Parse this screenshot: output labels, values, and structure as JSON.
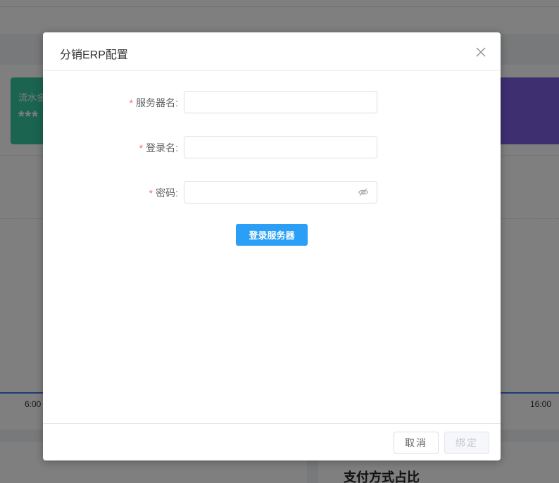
{
  "background": {
    "card_green": {
      "label": "流水金",
      "value": "***"
    },
    "chart": {
      "x_ticks": [
        "6:00",
        "16:00"
      ]
    },
    "section_title": "支付方式占比",
    "colors": {
      "card_green": "#36c9a0",
      "card_purple": "#7a5ee0",
      "chart_line": "#3e7bf0"
    }
  },
  "dialog": {
    "title": "分销ERP配置",
    "close_icon": "close-icon",
    "form": {
      "required_mark": "*",
      "fields": [
        {
          "label": "服务器名:",
          "value": "",
          "placeholder": ""
        },
        {
          "label": "登录名:",
          "value": "",
          "placeholder": ""
        },
        {
          "label": "密码:",
          "value": "",
          "placeholder": "",
          "icon": "eye-off-icon"
        }
      ]
    },
    "login_button": "登录服务器",
    "footer": {
      "cancel": "取消",
      "bind": "绑定"
    },
    "colors": {
      "primary": "#2a9ff5",
      "required": "#f56c6c"
    }
  }
}
